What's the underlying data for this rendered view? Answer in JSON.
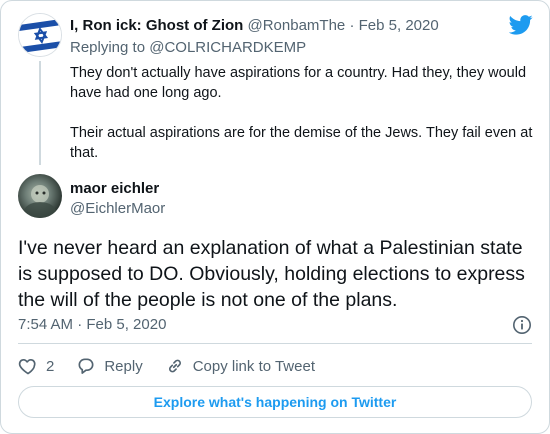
{
  "parent_tweet": {
    "display_name": "I, Ron ick: Ghost of Zion",
    "handle": "@RonbamThe",
    "separator": "·",
    "date": "Feb 5, 2020",
    "replying_prefix": "Replying to",
    "replying_to": "@COLRICHARDKEMP",
    "paragraphs": [
      "They don't actually have aspirations for a country. Had they, they would have had one long ago.",
      "Their actual aspirations are for the demise of the Jews. They fail even at that."
    ]
  },
  "main_tweet": {
    "display_name": "maor eichler",
    "handle": "@EichlerMaor",
    "text": "I've never heard an explanation of what a Palestinian state is supposed to DO. Obviously, holding elections to express the will of the people is not one of the plans.",
    "timestamp": "7:54 AM · Feb 5, 2020"
  },
  "actions": {
    "like_count": "2",
    "reply_label": "Reply",
    "copy_link_label": "Copy link to Tweet"
  },
  "explore_label": "Explore what's happening on Twitter",
  "colors": {
    "accent": "#1d9bf0",
    "text": "#0f1419",
    "muted": "#536471",
    "border": "#cfd9de"
  },
  "icons": {
    "brand": "twitter-bird-icon",
    "info": "info-icon",
    "like": "heart-icon",
    "reply": "reply-bubble-icon",
    "link": "link-icon"
  }
}
